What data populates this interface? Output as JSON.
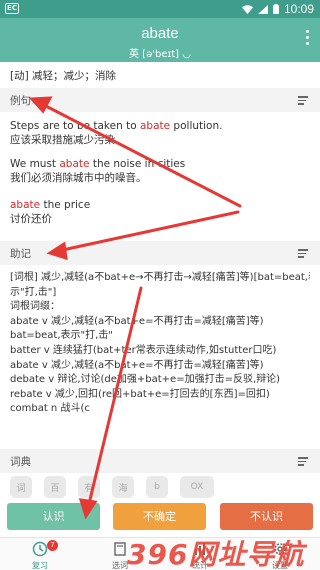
{
  "status_bar": {
    "time": "10:09",
    "app_icon_text": "EC"
  },
  "header": {
    "word": "abate",
    "phonetic": "英 [ə'beɪt] ◡"
  },
  "definition": "[动] 减轻；减少；消除",
  "sections": {
    "examples_title": "例句",
    "memory_title": "助记",
    "dictionary_title": "词典"
  },
  "examples": [
    {
      "en_pre": "Steps are to",
      "en_mid": " be taken to ",
      "en_hl": "abate",
      "en_post": " pollution.",
      "zh": "应该采取措施减少污染"
    },
    {
      "en_pre": "We must ",
      "en_hl": "abate",
      "en_post": " the noise in cities",
      "zh": "我们必须消除城市中的噪音。"
    },
    {
      "en_hl": "abate",
      "en_post": " the price",
      "zh": "讨价还价"
    }
  ],
  "memory_lines": [
    "[词根] 减少,减轻(a不bat+e→不再打击→减轻[痛苦]等)[bat=beat,表",
    "示\"打,击\"]",
    "词根词缀：",
    "abate v 减少,减轻(a不bat+e=不再打击=减轻[痛苦]等)",
    "bat=beat,表示\"打,击\"",
    "batter v 连续猛打(bat+ter常表示连续动作,如stutter口吃)",
    "abate v 减少,减轻(a不bat+e=不再打击=减轻[痛苦]等)",
    "debate v 辩论,讨论(de加强+bat+e=加强打击=反驳,辩论)",
    "rebate v 减少,回扣(re回+bat+e=打回去的[东西]=回扣)",
    "combat n 战斗(c"
  ],
  "dict_icons": [
    "词",
    "百",
    "有",
    "海",
    "b",
    "OX"
  ],
  "buttons": {
    "know": "认识",
    "unsure": "不确定",
    "unknown": "不认识"
  },
  "nav": {
    "review": "复习",
    "review_badge": "7",
    "wordbook": "选词",
    "stats": "统计",
    "settings": "设置"
  },
  "watermark": "396网址导航",
  "colors": {
    "primary": "#5fb7a6",
    "know": "#6fc2a5",
    "unsure": "#f0a13e",
    "unknown": "#e56e45",
    "highlight": "#d62a2a"
  }
}
